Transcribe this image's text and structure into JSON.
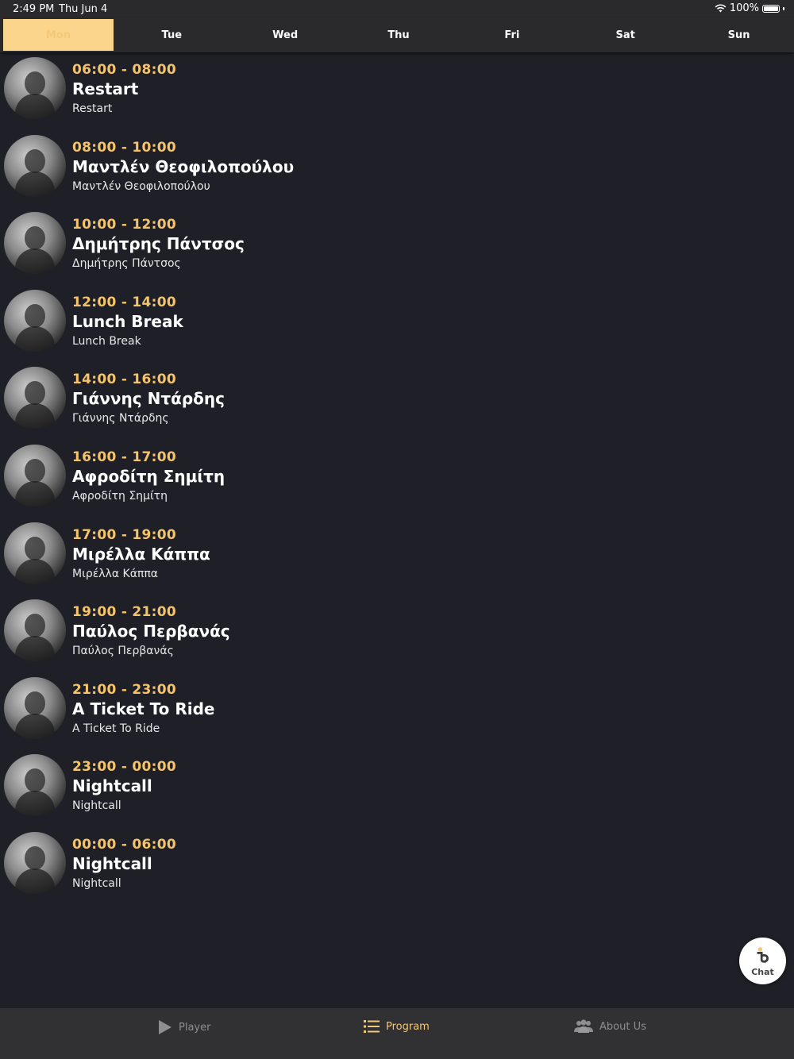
{
  "status": {
    "time": "2:49 PM",
    "date": "Thu Jun 4",
    "battery": "100%"
  },
  "days": [
    "Mon",
    "Tue",
    "Wed",
    "Thu",
    "Fri",
    "Sat",
    "Sun"
  ],
  "active_day": "Mon",
  "shows": [
    {
      "time": "06:00 - 08:00",
      "title": "Restart",
      "subtitle": "Restart"
    },
    {
      "time": "08:00 - 10:00",
      "title": "Μαντλέν Θεοφιλοπούλου",
      "subtitle": "Μαντλέν Θεοφιλοπούλου"
    },
    {
      "time": "10:00 - 12:00",
      "title": "Δημήτρης Πάντσος",
      "subtitle": "Δημήτρης Πάντσος"
    },
    {
      "time": "12:00 - 14:00",
      "title": "Lunch Break",
      "subtitle": "Lunch Break"
    },
    {
      "time": "14:00 - 16:00",
      "title": "Γιάννης Ντάρδης",
      "subtitle": "Γιάννης Ντάρδης"
    },
    {
      "time": "16:00 - 17:00",
      "title": "Αφροδίτη Σημίτη",
      "subtitle": "Αφροδίτη Σημίτη"
    },
    {
      "time": "17:00 - 19:00",
      "title": "Μιρέλλα Κάππα",
      "subtitle": "Μιρέλλα Κάππα"
    },
    {
      "time": "19:00 - 21:00",
      "title": "Παύλος Περβανάς",
      "subtitle": "Παύλος Περβανάς"
    },
    {
      "time": "21:00 - 23:00",
      "title": "A Ticket To Ride",
      "subtitle": "A Ticket To Ride"
    },
    {
      "time": "23:00 - 00:00",
      "title": "Nightcall",
      "subtitle": "Nightcall"
    },
    {
      "time": "00:00 - 06:00",
      "title": "Nightcall",
      "subtitle": "Nightcall"
    }
  ],
  "chat": {
    "label": "Chat"
  },
  "bottom_nav": [
    {
      "label": "Player",
      "icon": "play-icon"
    },
    {
      "label": "Program",
      "icon": "list-icon"
    },
    {
      "label": "About Us",
      "icon": "users-icon"
    }
  ],
  "active_nav": "Program",
  "colors": {
    "accent": "#f5c46a",
    "active_tab_bg": "#fbd58c",
    "background": "#1f2027",
    "bar": "#2a2a2d"
  }
}
